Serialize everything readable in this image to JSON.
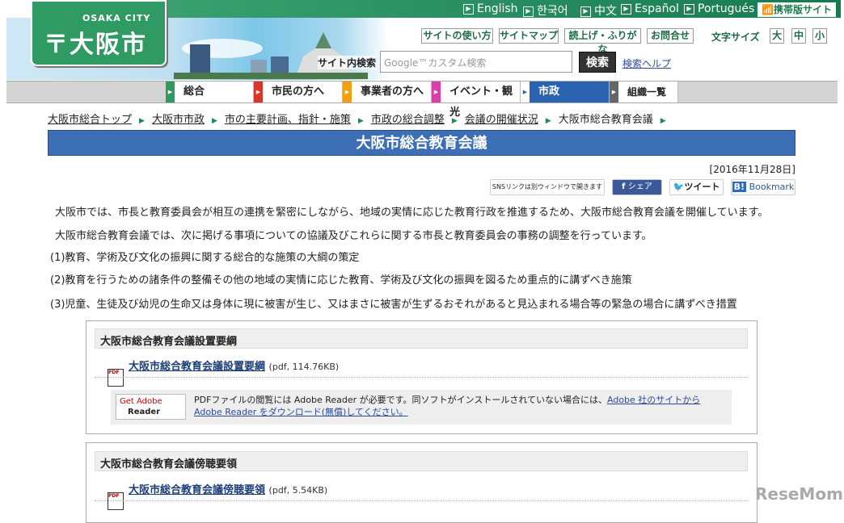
{
  "header": {
    "logo_en": "OSAKA CITY",
    "logo_jp": "大阪市",
    "languages": [
      "English",
      "한국어",
      "中文",
      "Español",
      "Portugués"
    ],
    "mobile": "携帯版サイト",
    "utility": [
      "サイトの使い方",
      "サイトマップ",
      "読上げ・ふりがな",
      "お問合せ"
    ],
    "font_size_label": "文字サイズ",
    "font_sizes": [
      "大",
      "中",
      "小"
    ],
    "search_label": "サイト内検索",
    "search_placeholder": "Google™カスタム検索",
    "search_button": "検索",
    "search_help": "検索ヘルプ"
  },
  "nav": [
    {
      "label": "総合",
      "color": "#2e9a5e"
    },
    {
      "label": "市民の方へ",
      "color": "#d9352a"
    },
    {
      "label": "事業者の方へ",
      "color": "#f0a010"
    },
    {
      "label": "イベント・観光",
      "color": "#d93fa8"
    },
    {
      "label": "市政",
      "color": "#2a63b0",
      "active": true
    },
    {
      "label": "組織一覧",
      "color": "#666666"
    }
  ],
  "breadcrumb": [
    "大阪市総合トップ",
    "大阪市市政",
    "市の主要計画、指針・施策",
    "市政の総合調整",
    "会議の開催状況",
    "大阪市総合教育会議"
  ],
  "page_title": "大阪市総合教育会議",
  "date": "[2016年11月28日]",
  "sns": {
    "note": "SNSリンクは別ウィンドウで開きます",
    "facebook": "シェア",
    "twitter": "ツイート",
    "hatena": "Bookmark"
  },
  "paragraphs": [
    "大阪市では、市長と教育委員会が相互の連携を緊密にしながら、地域の実情に応じた教育行政を推進するため、大阪市総合教育会議を開催しています。",
    "大阪市総合教育会議では、次に掲げる事項についての協議及びこれらに関する市長と教育委員会の事務の調整を行っています。",
    "(1)教育、学術及び文化の振興に関する総合的な施策の大綱の策定",
    "(2)教育を行うための諸条件の整備その他の地域の実情に応じた教育、学術及び文化の振興を図るため重点的に講ずべき施策",
    "(3)児童、生徒及び幼児の生命又は身体に現に被害が生じ、又はまさに被害が生ずるおそれがあると見込まれる場合等の緊急の場合に講ずべき措置"
  ],
  "sections": [
    {
      "heading": "大阪市総合教育会議設置要綱",
      "link": "大阪市総合教育会議設置要綱",
      "size": "(pdf, 114.76KB)"
    },
    {
      "heading": "大阪市総合教育会議傍聴要領",
      "link": "大阪市総合教育会議傍聴要領",
      "size": "(pdf, 5.54KB)"
    }
  ],
  "adobe": {
    "logo_get": "Get Adobe",
    "logo_reader": "Reader",
    "text": "PDFファイルの閲覧には Adobe Reader が必要です。同ソフトがインストールされていない場合には、",
    "link": "Adobe 社のサイトから Adobe Reader をダウンロード(無償)してください。"
  },
  "watermark": "ReseMom"
}
